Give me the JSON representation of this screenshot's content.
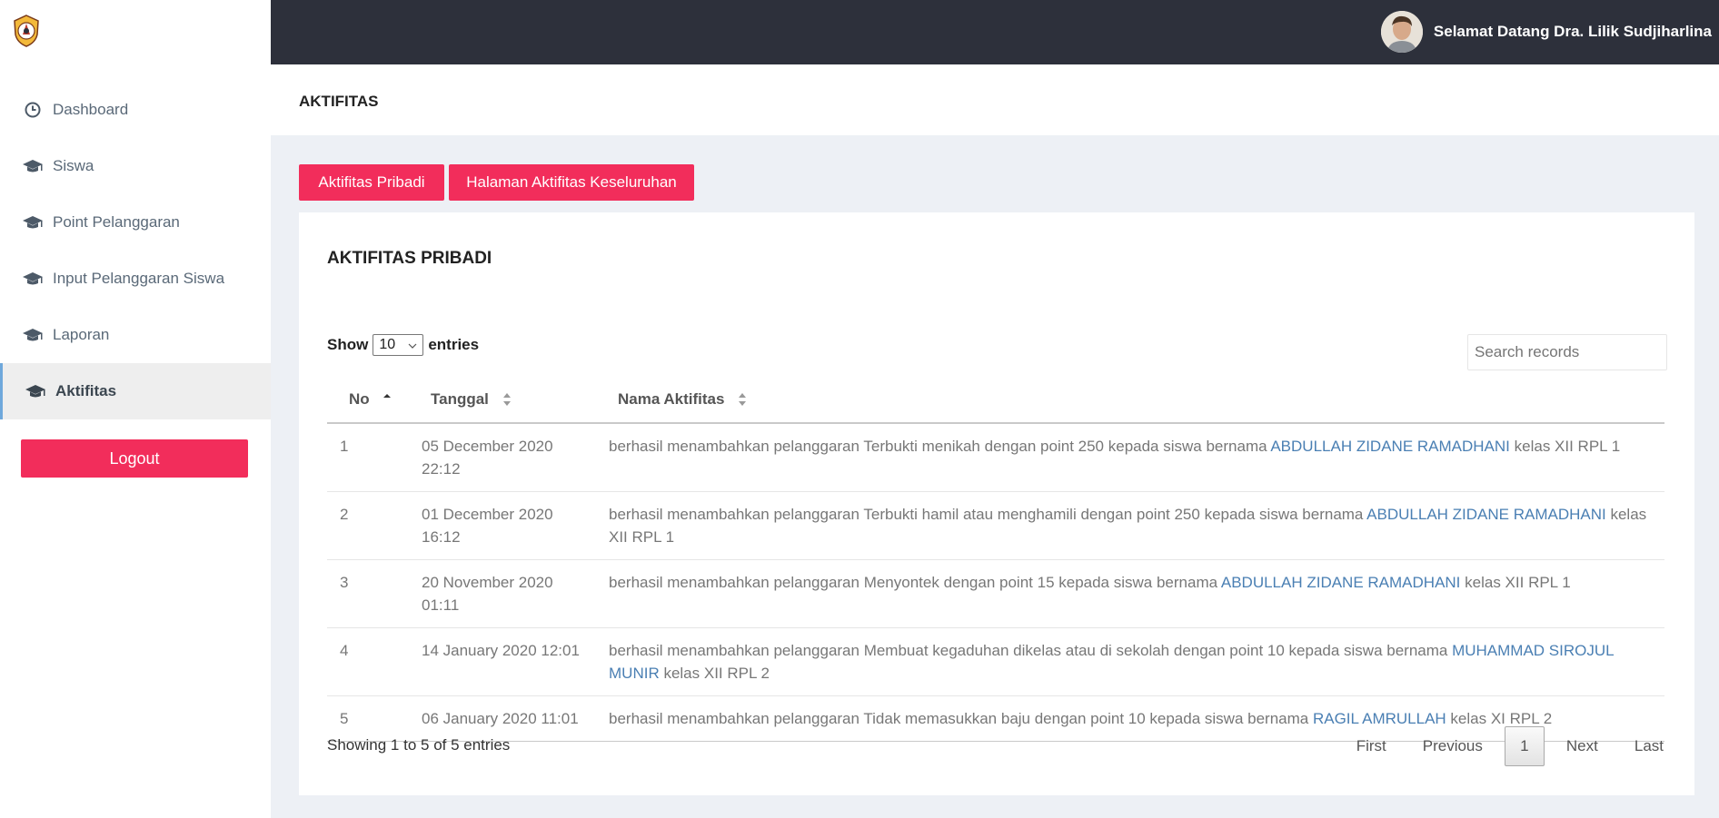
{
  "sidebar": {
    "items": [
      {
        "label": "Dashboard",
        "icon": "clock-icon"
      },
      {
        "label": "Siswa",
        "icon": "graduation-cap-icon"
      },
      {
        "label": "Point Pelanggaran",
        "icon": "graduation-cap-icon"
      },
      {
        "label": "Input Pelanggaran Siswa",
        "icon": "graduation-cap-icon"
      },
      {
        "label": "Laporan",
        "icon": "graduation-cap-icon"
      },
      {
        "label": "Aktifitas",
        "icon": "graduation-cap-icon",
        "active": true
      }
    ],
    "logout_label": "Logout"
  },
  "topbar": {
    "welcome": "Selamat Datang Dra. Lilik Sudjiharlina"
  },
  "page": {
    "title": "AKTIFITAS",
    "btn_pribadi": "Aktifitas Pribadi",
    "btn_keseluruhan": "Halaman Aktifitas Keseluruhan"
  },
  "card": {
    "title": "AKTIFITAS PRIBADI",
    "show_label": "Show",
    "entries_value": "10",
    "entries_label": "entries",
    "search_placeholder": "Search records",
    "columns": [
      "No",
      "Tanggal",
      "Nama Aktifitas"
    ],
    "rows": [
      {
        "no": "1",
        "tanggal": "05 December 2020 22:12",
        "pre": "berhasil menambahkan pelanggaran Terbukti menikah dengan point 250 kepada siswa bernama ",
        "nama": "ABDULLAH ZIDANE RAMADHANI",
        "post": " kelas XII RPL 1"
      },
      {
        "no": "2",
        "tanggal": "01 December 2020 16:12",
        "pre": "berhasil menambahkan pelanggaran Terbukti hamil atau menghamili dengan point 250 kepada siswa bernama ",
        "nama": "ABDULLAH ZIDANE RAMADHANI",
        "post": " kelas XII RPL 1"
      },
      {
        "no": "3",
        "tanggal": "20 November 2020 01:11",
        "pre": "berhasil menambahkan pelanggaran Menyontek dengan point 15 kepada siswa bernama ",
        "nama": "ABDULLAH ZIDANE RAMADHANI",
        "post": " kelas XII RPL 1"
      },
      {
        "no": "4",
        "tanggal": "14 January 2020 12:01",
        "pre": "berhasil menambahkan pelanggaran Membuat kegaduhan dikelas atau di sekolah dengan point 10 kepada siswa bernama ",
        "nama": "MUHAMMAD SIROJUL MUNIR",
        "post": " kelas XII RPL 2"
      },
      {
        "no": "5",
        "tanggal": "06 January 2020 11:01",
        "pre": "berhasil menambahkan pelanggaran Tidak memasukkan baju dengan point 10 kepada siswa bernama ",
        "nama": "RAGIL AMRULLAH",
        "post": " kelas XI RPL 2"
      }
    ],
    "info": "Showing 1 to 5 of 5 entries",
    "pager": {
      "first": "First",
      "previous": "Previous",
      "current": "1",
      "next": "Next",
      "last": "Last"
    }
  }
}
